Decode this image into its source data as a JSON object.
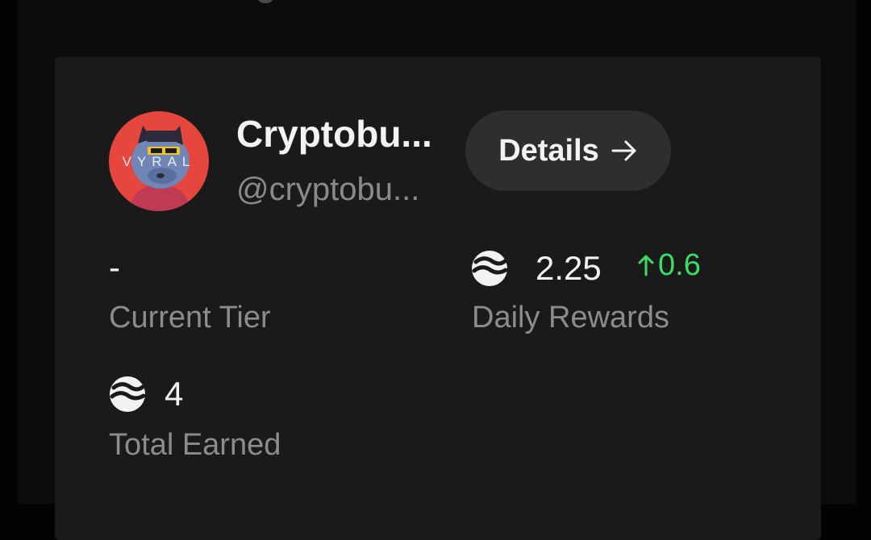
{
  "profile": {
    "name": "Cryptobu...",
    "handle": "@cryptobu...",
    "avatar_text": "VYRAL"
  },
  "details_button": {
    "label": "Details",
    "icon": "arrow-right-icon"
  },
  "stats": {
    "current_tier": {
      "value": "-",
      "label": "Current Tier"
    },
    "daily_rewards": {
      "icon": "token-icon",
      "value": "2.25",
      "change": "0.6",
      "change_icon": "arrow-up-icon",
      "label": "Daily Rewards"
    },
    "total_earned": {
      "icon": "token-icon",
      "value": "4",
      "label": "Total Earned"
    }
  },
  "colors": {
    "background": "#0c0c0c",
    "card": "#1a1a1a",
    "button": "#2e2e2e",
    "positive": "#3ddc64",
    "label": "#8c8c8c"
  }
}
